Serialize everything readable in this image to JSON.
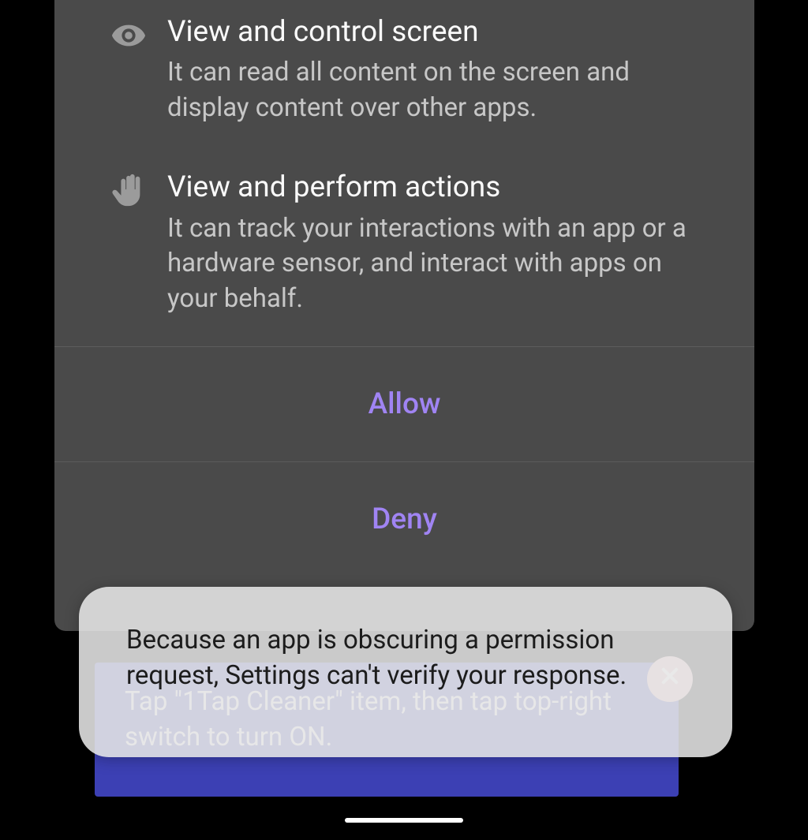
{
  "permissions": [
    {
      "icon": "eye-icon",
      "title": "View and control screen",
      "desc": "It can read all content on the screen and display content over other apps."
    },
    {
      "icon": "hand-icon",
      "title": "View and perform actions",
      "desc": "It can track your interactions with an app or a hardware sensor, and interact with apps on your behalf."
    }
  ],
  "buttons": {
    "allow": "Allow",
    "deny": "Deny"
  },
  "instruction_banner": {
    "text": "Tap \"1Tap Cleaner\" item, then tap top-right switch to turn ON."
  },
  "toast": {
    "text": "Because an app is obscuring a permission request, Settings can't verify your response."
  },
  "colors": {
    "accent": "#A084F3",
    "banner": "#3C40B4"
  }
}
